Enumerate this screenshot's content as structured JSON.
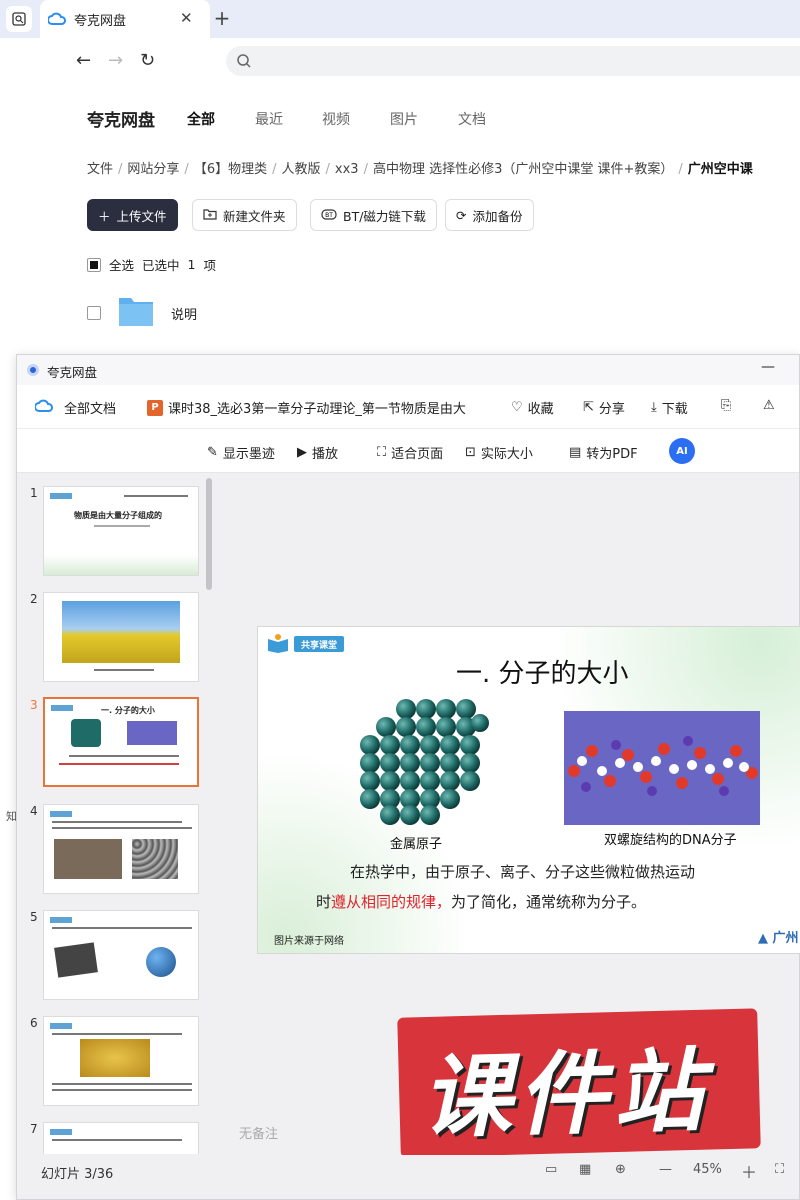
{
  "browser": {
    "tab_title": "夸克网盘",
    "close_glyph": "✕",
    "new_tab_glyph": "+"
  },
  "app": {
    "title": "夸克网盘",
    "nav": [
      "全部",
      "最近",
      "视频",
      "图片",
      "文档"
    ],
    "breadcrumb": [
      "文件",
      "网站分享",
      "【6】物理类",
      "人教版",
      "xx3",
      "高中物理 选择性必修3（广州空中课堂 课件+教案）",
      "广州空中课"
    ],
    "buttons": {
      "upload": "上传文件",
      "new_folder": "新建文件夹",
      "bt": "BT/磁力链下载",
      "backup": "添加备份"
    },
    "select_all": "全选",
    "selected_text": "已选中",
    "selected_count": "1",
    "selected_unit": "项",
    "file_name": "说明"
  },
  "viewer": {
    "window_title": "夸克网盘",
    "all_docs": "全部文档",
    "doc_title": "课时38_选必3第一章分子动理论_第一节物质是由大",
    "favorite": "收藏",
    "share": "分享",
    "download": "下载",
    "show_ink": "显示墨迹",
    "play": "播放",
    "fit_page": "适合页面",
    "actual_size": "实际大小",
    "to_pdf": "转为PDF",
    "ai": "AI",
    "no_notes": "无备注",
    "slide_count": "幻灯片 3/36",
    "zoom": "45%",
    "left_edge_char": "知"
  },
  "thumbnails": [
    {
      "num": "1",
      "text": "物质是由大量分子组成的"
    },
    {
      "num": "2",
      "text": ""
    },
    {
      "num": "3",
      "text": "一. 分子的大小"
    },
    {
      "num": "4",
      "text": ""
    },
    {
      "num": "5",
      "text": ""
    },
    {
      "num": "6",
      "text": ""
    },
    {
      "num": "7",
      "text": ""
    }
  ],
  "slide": {
    "logo_tag": "共享课堂",
    "title": "一. 分子的大小",
    "caption_left": "金属原子",
    "caption_right": "双螺旋结构的DNA分子",
    "line1": "在热学中，由于原子、离子、分子这些微粒做热运动",
    "line2_pre": "时",
    "line2_highlight": "遵从相同的规律，",
    "line2_post": "为了简化，通常统称为分子。",
    "source_note": "图片来源于网络",
    "brand": "广州"
  },
  "stamp": {
    "text": "课件站"
  },
  "colors": {
    "accent": "#e9743a",
    "primary_btn": "#2b2e3f",
    "highlight": "#e0232b",
    "stamp": "#d7343b"
  }
}
